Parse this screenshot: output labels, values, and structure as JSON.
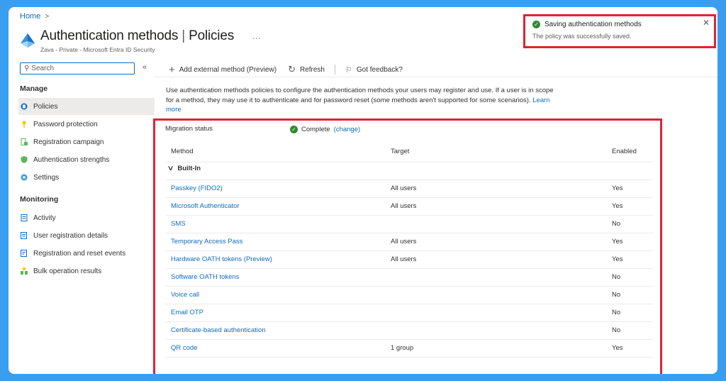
{
  "breadcrumb": {
    "home": "Home",
    "separator": ">"
  },
  "header": {
    "title_main": "Authentication methods",
    "title_separator": "|",
    "title_sub": "Policies",
    "more": "...",
    "subtitle": "Zava - Private - Microsoft Entra ID Security"
  },
  "toast": {
    "title": "Saving authentication methods",
    "message": "The policy was successfully saved.",
    "close": "✕"
  },
  "sidebar": {
    "search_placeholder": "Search",
    "collapse": "«",
    "manage_label": "Manage",
    "manage_items": [
      {
        "label": "Policies",
        "icon": "policies-icon",
        "color": "#0f6cbd",
        "active": true
      },
      {
        "label": "Password protection",
        "icon": "key-icon",
        "color": "#f2c811"
      },
      {
        "label": "Registration campaign",
        "icon": "registration-icon",
        "color": "#5bb75b"
      },
      {
        "label": "Authentication strengths",
        "icon": "shield-icon",
        "color": "#5bb75b"
      },
      {
        "label": "Settings",
        "icon": "gear-icon",
        "color": "#3aa0d8"
      }
    ],
    "monitoring_label": "Monitoring",
    "monitoring_items": [
      {
        "label": "Activity",
        "icon": "activity-icon",
        "color": "#0f6cbd"
      },
      {
        "label": "User registration details",
        "icon": "user-details-icon",
        "color": "#0f6cbd"
      },
      {
        "label": "Registration and reset events",
        "icon": "events-icon",
        "color": "#0f6cbd"
      },
      {
        "label": "Bulk operation results",
        "icon": "bulk-icon",
        "color": "#5bb75b"
      }
    ]
  },
  "toolbar": {
    "add_label": "Add external method (Preview)",
    "refresh_label": "Refresh",
    "feedback_label": "Got feedback?"
  },
  "description": {
    "text": "Use authentication methods policies to configure the authentication methods your users may register and use. If a user is in scope for a method, they may use it to authenticate and for password reset (some methods aren't supported for some scenarios).",
    "learn_more": "Learn more"
  },
  "migration": {
    "label": "Migration status",
    "status": "Complete",
    "change": "(change)"
  },
  "table": {
    "headers": {
      "method": "Method",
      "target": "Target",
      "enabled": "Enabled"
    },
    "group": "Built-In",
    "rows": [
      {
        "method": "Passkey (FIDO2)",
        "target": "All users",
        "enabled": "Yes"
      },
      {
        "method": "Microsoft Authenticator",
        "target": "All users",
        "enabled": "Yes"
      },
      {
        "method": "SMS",
        "target": "",
        "enabled": "No"
      },
      {
        "method": "Temporary Access Pass",
        "target": "All users",
        "enabled": "Yes"
      },
      {
        "method": "Hardware OATH tokens (Preview)",
        "target": "All users",
        "enabled": "Yes"
      },
      {
        "method": "Software OATH tokens",
        "target": "",
        "enabled": "No"
      },
      {
        "method": "Voice call",
        "target": "",
        "enabled": "No"
      },
      {
        "method": "Email OTP",
        "target": "",
        "enabled": "No"
      },
      {
        "method": "Certificate-based authentication",
        "target": "",
        "enabled": "No"
      },
      {
        "method": "QR code",
        "target": "1 group",
        "enabled": "Yes"
      }
    ]
  },
  "colors": {
    "frame": "#3a9ef0",
    "highlight": "#e0242f",
    "link": "#0f6cbd",
    "success": "#2e8b2e"
  }
}
